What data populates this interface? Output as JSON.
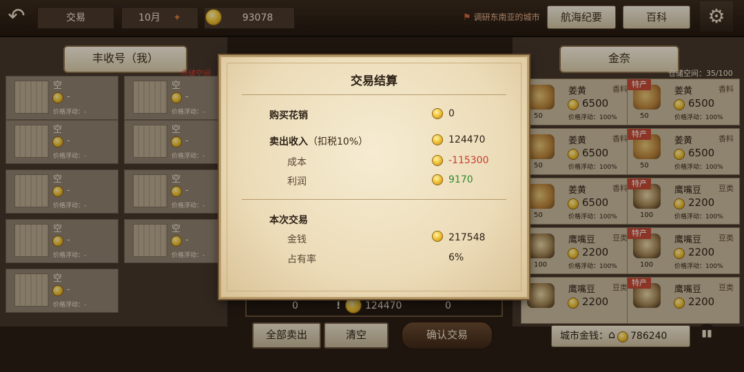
{
  "topbar": {
    "back_icon": "back-arrow-icon",
    "mode_label": "交易",
    "month": "10月",
    "player_gold": "93078",
    "quest_text": "调研东南亚的城市",
    "nav_log_label": "航海纪要",
    "wiki_label": "百科",
    "settings_icon": "gear-icon"
  },
  "ship_panel": {
    "title": "丰收号（我）",
    "capacity_label": "仓储空间",
    "slots": [
      {
        "name": "空",
        "value": "-",
        "fluct": "价格浮动：-"
      },
      {
        "name": "空",
        "value": "-",
        "fluct": "价格浮动：-"
      },
      {
        "name": "空",
        "value": "-",
        "fluct": "价格浮动：-"
      },
      {
        "name": "空",
        "value": "-",
        "fluct": "价格浮动：-"
      },
      {
        "name": "空",
        "value": "-",
        "fluct": "价格浮动：-"
      },
      {
        "name": "空",
        "value": "-",
        "fluct": "价格浮动：-"
      },
      {
        "name": "空",
        "value": "-",
        "fluct": "价格浮动：-"
      },
      {
        "name": "空",
        "value": "-",
        "fluct": "价格浮动：-"
      },
      {
        "name": "空",
        "value": "-",
        "fluct": "价格浮动：-"
      }
    ]
  },
  "city_panel": {
    "title": "金奈",
    "capacity": "仓储空间：35/100",
    "special_tag": "特产",
    "goods": [
      {
        "name": "姜黄",
        "cat": "香料",
        "price": "6500",
        "fluct": "价格浮动：100%",
        "qty": "50",
        "special": false
      },
      {
        "name": "姜黄",
        "cat": "香料",
        "price": "6500",
        "fluct": "价格浮动：100%",
        "qty": "50",
        "special": true
      },
      {
        "name": "姜黄",
        "cat": "香料",
        "price": "6500",
        "fluct": "价格浮动：100%",
        "qty": "50",
        "special": false
      },
      {
        "name": "姜黄",
        "cat": "香料",
        "price": "6500",
        "fluct": "价格浮动：100%",
        "qty": "50",
        "special": true
      },
      {
        "name": "姜黄",
        "cat": "香料",
        "price": "6500",
        "fluct": "价格浮动：100%",
        "qty": "50",
        "special": false
      },
      {
        "name": "鹰嘴豆",
        "cat": "豆类",
        "price": "2200",
        "fluct": "价格浮动：100%",
        "qty": "100",
        "special": true
      },
      {
        "name": "鹰嘴豆",
        "cat": "豆类",
        "price": "2200",
        "fluct": "价格浮动：100%",
        "qty": "100",
        "special": false
      },
      {
        "name": "鹰嘴豆",
        "cat": "豆类",
        "price": "2200",
        "fluct": "价格浮动：100%",
        "qty": "100",
        "special": true
      },
      {
        "name": "鹰嘴豆",
        "cat": "豆类",
        "price": "2200",
        "fluct": "",
        "qty": "",
        "special": false
      },
      {
        "name": "鹰嘴豆",
        "cat": "豆类",
        "price": "2200",
        "fluct": "",
        "qty": "",
        "special": true
      }
    ]
  },
  "middle": {
    "left_count": "0",
    "total": "124470",
    "right_count": "0",
    "warn_icon": "!"
  },
  "actions": {
    "sell_all": "全部卖出",
    "clear": "清空",
    "confirm": "确认交易",
    "city_money_label": "城市金钱：",
    "city_money_value": "786240",
    "home_icon": "home-icon",
    "stats_icon": "bar-chart-icon"
  },
  "dialog": {
    "title": "交易结算",
    "buy_label": "购买花销",
    "buy_value": "0",
    "sell_label": "卖出收入",
    "sell_note": "（扣税10%）",
    "sell_value": "124470",
    "cost_label": "成本",
    "cost_value": "-115300",
    "profit_label": "利润",
    "profit_value": "9170",
    "session_label": "本次交易",
    "money_label": "金钱",
    "money_value": "217548",
    "share_label": "占有率",
    "share_value": "6%"
  }
}
